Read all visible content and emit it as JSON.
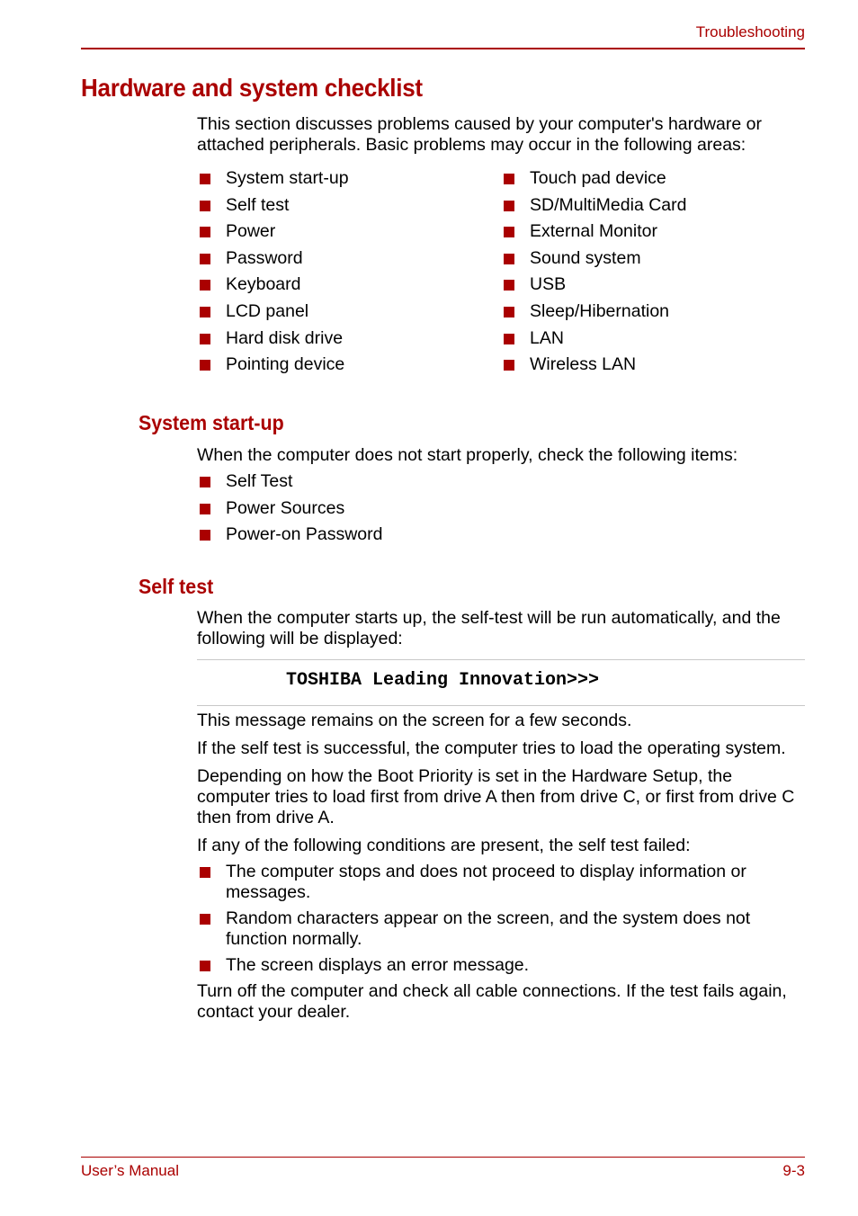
{
  "header": {
    "chapter": "Troubleshooting"
  },
  "title": "Hardware and system checklist",
  "intro": "This section discusses problems caused by your computer's hardware or attached peripherals. Basic problems may occur in the following areas:",
  "areas": {
    "left": [
      "System start-up",
      "Self test",
      "Power",
      "Password",
      "Keyboard",
      "LCD panel",
      "Hard disk drive",
      "Pointing device"
    ],
    "right": [
      "Touch pad device",
      "SD/MultiMedia Card",
      "External Monitor",
      "Sound system",
      "USB",
      "Sleep/Hibernation",
      "LAN",
      "Wireless LAN"
    ]
  },
  "system_startup": {
    "heading": "System start-up",
    "intro": "When the computer does not start properly, check the following items:",
    "items": [
      "Self Test",
      "Power Sources",
      "Power-on Password"
    ]
  },
  "self_test": {
    "heading": "Self test",
    "intro": "When the computer starts up, the self-test will be run automatically, and the following will be displayed:",
    "code": "TOSHIBA Leading Innovation>>>",
    "paragraphs": [
      "This message remains on the screen for a few seconds.",
      "If the self test is successful, the computer tries to load the operating system.",
      "Depending on how the Boot Priority is set in the Hardware Setup, the computer tries to load first from drive A then from drive C, or first from drive C then from drive A.",
      "If any of the following conditions are present, the self test failed:"
    ],
    "conditions": [
      "The computer stops and does not proceed to display information or messages.",
      "Random characters appear on the screen, and the system does not function normally.",
      "The screen displays an error message."
    ],
    "closing": "Turn off the computer and check all cable connections. If the test fails again, contact your dealer."
  },
  "footer": {
    "left": "User’s Manual",
    "right": "9-3"
  },
  "colors": {
    "accent": "#aa0000",
    "rule": "#c8c8c8"
  }
}
